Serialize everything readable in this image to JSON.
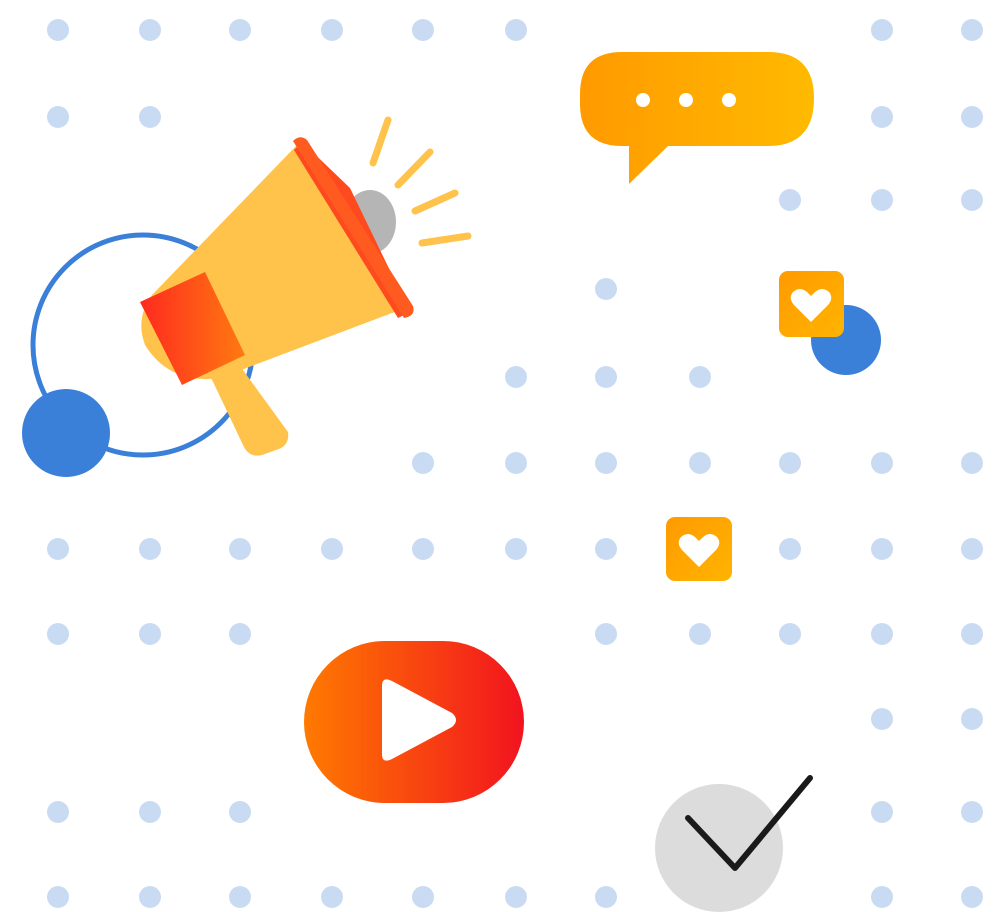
{
  "colors": {
    "background": "#ffffff",
    "dot": "#c9dbf3",
    "blue_accent": "#3a7fd8",
    "orange_light": "#ffb800",
    "orange_mid": "#ff8c00",
    "red_orange": "#f22a1f",
    "megaphone_body": "#ffc24a",
    "megaphone_rim": "#ff5a1f",
    "speaker_gray": "#b5b5b5",
    "check_circle": "#dcdcdc",
    "check_mark": "#1a1a1a"
  },
  "icons": [
    "megaphone-icon",
    "chat-bubble-icon",
    "heart-icon",
    "play-button-icon",
    "checkmark-icon"
  ]
}
